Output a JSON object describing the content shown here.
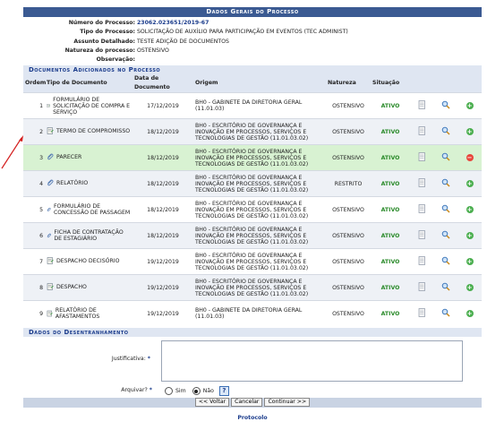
{
  "header": {
    "title": "Dados Gerais do Processo"
  },
  "info": [
    {
      "label": "Número do Processo:",
      "value": "23062.023651/2019-67"
    },
    {
      "label": "Tipo do Processo:",
      "value": "SOLICITAÇÃO DE AUXÍLIO PARA PARTICIPAÇÃO EM EVENTOS (TEC ADMINIST)"
    },
    {
      "label": "Assunto Detalhado:",
      "value": "TESTE ADIÇÃO DE DOCUMENTOS"
    },
    {
      "label": "Natureza do processo:",
      "value": "OSTENSIVO"
    },
    {
      "label": "Observação:",
      "value": ""
    }
  ],
  "docs_section": {
    "title": "Documentos Adicionados no Processo"
  },
  "columns": {
    "ordem": "Ordem",
    "tipo": "Tipo de Documento",
    "data": "Data de Documento",
    "origem": "Origem",
    "natureza": "Natureza",
    "situacao": "Situação"
  },
  "documents": [
    {
      "ordem": "1",
      "tipo": "FORMULÁRIO DE SOLICITAÇÃO DE COMPRA E SERVIÇO",
      "icon": "document-icon",
      "data": "17/12/2019",
      "origem": "BH0 - GABINETE DA DIRETORIA GERAL (11.01.03)",
      "natureza": "OSTENSIVO",
      "situacao": "ATIVO",
      "action": "add"
    },
    {
      "ordem": "2",
      "tipo": "TERMO DE COMPROMISSO",
      "icon": "document-icon",
      "data": "18/12/2019",
      "origem": "BH0 - ESCRITÓRIO DE GOVERNANÇA E INOVAÇÃO EM PROCESSOS, SERVIÇOS E TECNOLOGIAS DE GESTÃO (11.01.03.02)",
      "natureza": "OSTENSIVO",
      "situacao": "ATIVO",
      "action": "add"
    },
    {
      "ordem": "3",
      "tipo": "PARECER",
      "icon": "attachment-icon",
      "data": "18/12/2019",
      "origem": "BH0 - ESCRITÓRIO DE GOVERNANÇA E INOVAÇÃO EM PROCESSOS, SERVIÇOS E TECNOLOGIAS DE GESTÃO (11.01.03.02)",
      "natureza": "OSTENSIVO",
      "situacao": "ATIVO",
      "action": "remove"
    },
    {
      "ordem": "4",
      "tipo": "RELATÓRIO",
      "icon": "attachment-icon",
      "data": "18/12/2019",
      "origem": "BH0 - ESCRITÓRIO DE GOVERNANÇA E INOVAÇÃO EM PROCESSOS, SERVIÇOS E TECNOLOGIAS DE GESTÃO (11.01.03.02)",
      "natureza": "RESTRITO",
      "situacao": "ATIVO",
      "action": "add"
    },
    {
      "ordem": "5",
      "tipo": "FORMULÁRIO DE CONCESSÃO DE PASSAGEM",
      "icon": "attachment-icon",
      "data": "18/12/2019",
      "origem": "BH0 - ESCRITÓRIO DE GOVERNANÇA E INOVAÇÃO EM PROCESSOS, SERVIÇOS E TECNOLOGIAS DE GESTÃO (11.01.03.02)",
      "natureza": "OSTENSIVO",
      "situacao": "ATIVO",
      "action": "add"
    },
    {
      "ordem": "6",
      "tipo": "FICHA DE CONTRATAÇÃO DE ESTAGIÁRIO",
      "icon": "attachment-icon",
      "data": "18/12/2019",
      "origem": "BH0 - ESCRITÓRIO DE GOVERNANÇA E INOVAÇÃO EM PROCESSOS, SERVIÇOS E TECNOLOGIAS DE GESTÃO (11.01.03.02)",
      "natureza": "OSTENSIVO",
      "situacao": "ATIVO",
      "action": "add"
    },
    {
      "ordem": "7",
      "tipo": "DESPACHO DECISÓRIO",
      "icon": "document-icon",
      "data": "19/12/2019",
      "origem": "BH0 - ESCRITÓRIO DE GOVERNANÇA E INOVAÇÃO EM PROCESSOS, SERVIÇOS E TECNOLOGIAS DE GESTÃO (11.01.03.02)",
      "natureza": "OSTENSIVO",
      "situacao": "ATIVO",
      "action": "add"
    },
    {
      "ordem": "8",
      "tipo": "DESPACHO",
      "icon": "document-icon",
      "data": "19/12/2019",
      "origem": "BH0 - ESCRITÓRIO DE GOVERNANÇA E INOVAÇÃO EM PROCESSOS, SERVIÇOS E TECNOLOGIAS DE GESTÃO (11.01.03.02)",
      "natureza": "OSTENSIVO",
      "situacao": "ATIVO",
      "action": "add"
    },
    {
      "ordem": "9",
      "tipo": "RELATÓRIO DE AFASTAMENTOS",
      "icon": "document-icon",
      "data": "19/12/2019",
      "origem": "BH0 - GABINETE DA DIRETORIA GERAL (11.01.03)",
      "natureza": "OSTENSIVO",
      "situacao": "ATIVO",
      "action": "add"
    }
  ],
  "desentranhamento": {
    "title": "Dados do Desentranhamento",
    "justificativa_label": "Justificativa:",
    "justificativa_value": "",
    "arquivar_label": "Arquivar?",
    "sim": "Sim",
    "nao": "Não",
    "selected": "Não",
    "help": "?"
  },
  "buttons": {
    "voltar": "<< Voltar",
    "cancelar": "Cancelar",
    "continuar": "Continuar >>"
  },
  "footer": {
    "link": "Protocolo"
  },
  "colors": {
    "header": "#3b5a92",
    "subheader": "#dfe6f2",
    "ativo": "#2a8a2a",
    "highlight": "#d8f2d2",
    "arrow": "#d42020"
  }
}
